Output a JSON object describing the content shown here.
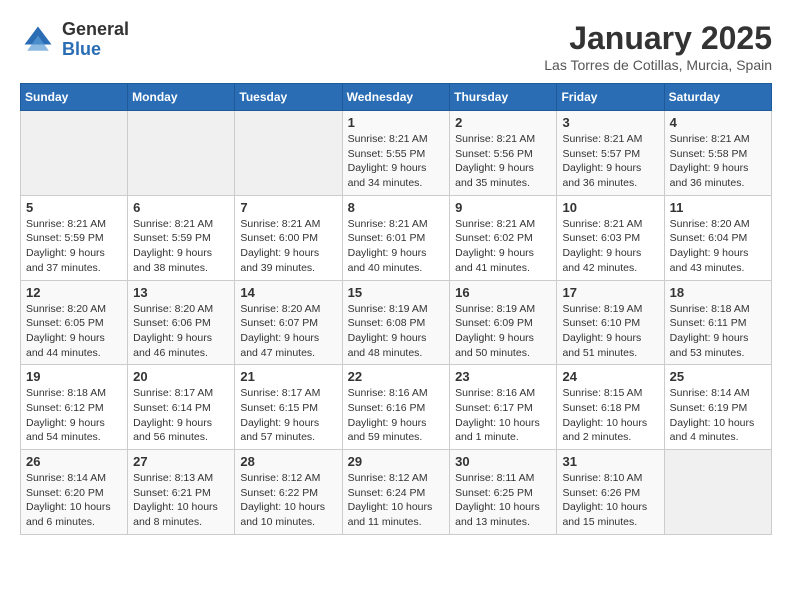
{
  "header": {
    "logo_line1": "General",
    "logo_line2": "Blue",
    "month": "January 2025",
    "location": "Las Torres de Cotillas, Murcia, Spain"
  },
  "weekdays": [
    "Sunday",
    "Monday",
    "Tuesday",
    "Wednesday",
    "Thursday",
    "Friday",
    "Saturday"
  ],
  "weeks": [
    [
      {
        "day": "",
        "info": ""
      },
      {
        "day": "",
        "info": ""
      },
      {
        "day": "",
        "info": ""
      },
      {
        "day": "1",
        "info": "Sunrise: 8:21 AM\nSunset: 5:55 PM\nDaylight: 9 hours and 34 minutes."
      },
      {
        "day": "2",
        "info": "Sunrise: 8:21 AM\nSunset: 5:56 PM\nDaylight: 9 hours and 35 minutes."
      },
      {
        "day": "3",
        "info": "Sunrise: 8:21 AM\nSunset: 5:57 PM\nDaylight: 9 hours and 36 minutes."
      },
      {
        "day": "4",
        "info": "Sunrise: 8:21 AM\nSunset: 5:58 PM\nDaylight: 9 hours and 36 minutes."
      }
    ],
    [
      {
        "day": "5",
        "info": "Sunrise: 8:21 AM\nSunset: 5:59 PM\nDaylight: 9 hours and 37 minutes."
      },
      {
        "day": "6",
        "info": "Sunrise: 8:21 AM\nSunset: 5:59 PM\nDaylight: 9 hours and 38 minutes."
      },
      {
        "day": "7",
        "info": "Sunrise: 8:21 AM\nSunset: 6:00 PM\nDaylight: 9 hours and 39 minutes."
      },
      {
        "day": "8",
        "info": "Sunrise: 8:21 AM\nSunset: 6:01 PM\nDaylight: 9 hours and 40 minutes."
      },
      {
        "day": "9",
        "info": "Sunrise: 8:21 AM\nSunset: 6:02 PM\nDaylight: 9 hours and 41 minutes."
      },
      {
        "day": "10",
        "info": "Sunrise: 8:21 AM\nSunset: 6:03 PM\nDaylight: 9 hours and 42 minutes."
      },
      {
        "day": "11",
        "info": "Sunrise: 8:20 AM\nSunset: 6:04 PM\nDaylight: 9 hours and 43 minutes."
      }
    ],
    [
      {
        "day": "12",
        "info": "Sunrise: 8:20 AM\nSunset: 6:05 PM\nDaylight: 9 hours and 44 minutes."
      },
      {
        "day": "13",
        "info": "Sunrise: 8:20 AM\nSunset: 6:06 PM\nDaylight: 9 hours and 46 minutes."
      },
      {
        "day": "14",
        "info": "Sunrise: 8:20 AM\nSunset: 6:07 PM\nDaylight: 9 hours and 47 minutes."
      },
      {
        "day": "15",
        "info": "Sunrise: 8:19 AM\nSunset: 6:08 PM\nDaylight: 9 hours and 48 minutes."
      },
      {
        "day": "16",
        "info": "Sunrise: 8:19 AM\nSunset: 6:09 PM\nDaylight: 9 hours and 50 minutes."
      },
      {
        "day": "17",
        "info": "Sunrise: 8:19 AM\nSunset: 6:10 PM\nDaylight: 9 hours and 51 minutes."
      },
      {
        "day": "18",
        "info": "Sunrise: 8:18 AM\nSunset: 6:11 PM\nDaylight: 9 hours and 53 minutes."
      }
    ],
    [
      {
        "day": "19",
        "info": "Sunrise: 8:18 AM\nSunset: 6:12 PM\nDaylight: 9 hours and 54 minutes."
      },
      {
        "day": "20",
        "info": "Sunrise: 8:17 AM\nSunset: 6:14 PM\nDaylight: 9 hours and 56 minutes."
      },
      {
        "day": "21",
        "info": "Sunrise: 8:17 AM\nSunset: 6:15 PM\nDaylight: 9 hours and 57 minutes."
      },
      {
        "day": "22",
        "info": "Sunrise: 8:16 AM\nSunset: 6:16 PM\nDaylight: 9 hours and 59 minutes."
      },
      {
        "day": "23",
        "info": "Sunrise: 8:16 AM\nSunset: 6:17 PM\nDaylight: 10 hours and 1 minute."
      },
      {
        "day": "24",
        "info": "Sunrise: 8:15 AM\nSunset: 6:18 PM\nDaylight: 10 hours and 2 minutes."
      },
      {
        "day": "25",
        "info": "Sunrise: 8:14 AM\nSunset: 6:19 PM\nDaylight: 10 hours and 4 minutes."
      }
    ],
    [
      {
        "day": "26",
        "info": "Sunrise: 8:14 AM\nSunset: 6:20 PM\nDaylight: 10 hours and 6 minutes."
      },
      {
        "day": "27",
        "info": "Sunrise: 8:13 AM\nSunset: 6:21 PM\nDaylight: 10 hours and 8 minutes."
      },
      {
        "day": "28",
        "info": "Sunrise: 8:12 AM\nSunset: 6:22 PM\nDaylight: 10 hours and 10 minutes."
      },
      {
        "day": "29",
        "info": "Sunrise: 8:12 AM\nSunset: 6:24 PM\nDaylight: 10 hours and 11 minutes."
      },
      {
        "day": "30",
        "info": "Sunrise: 8:11 AM\nSunset: 6:25 PM\nDaylight: 10 hours and 13 minutes."
      },
      {
        "day": "31",
        "info": "Sunrise: 8:10 AM\nSunset: 6:26 PM\nDaylight: 10 hours and 15 minutes."
      },
      {
        "day": "",
        "info": ""
      }
    ]
  ]
}
